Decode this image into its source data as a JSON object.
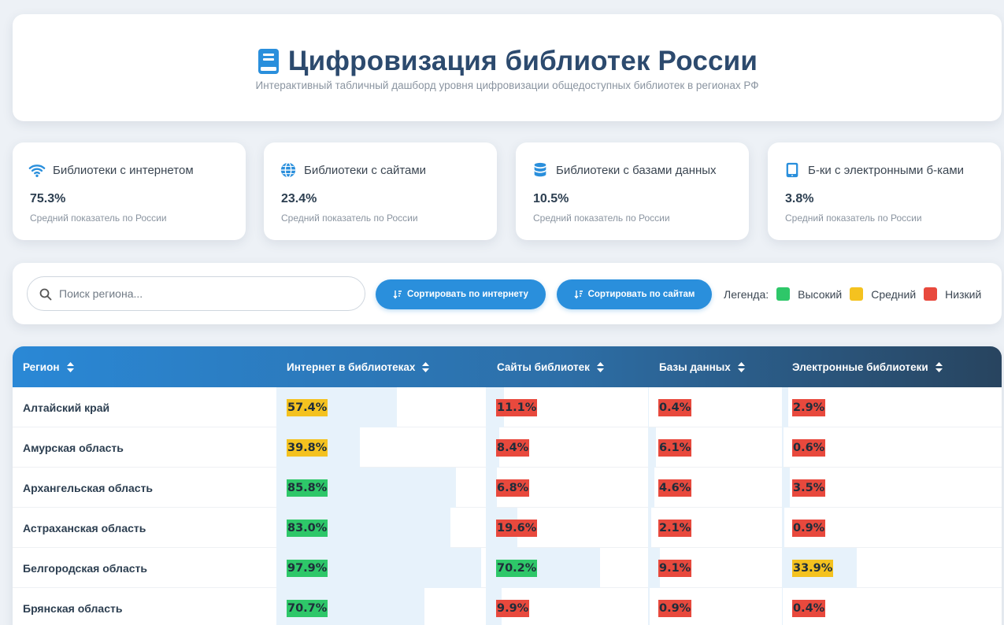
{
  "header": {
    "title": "Цифровизация библиотек России",
    "subtitle": "Интерактивный табличный дашборд уровня цифровизации общедоступных библиотек в регионах РФ"
  },
  "stats": [
    {
      "label": "Библиотеки с интернетом",
      "value": "75.3%",
      "note": "Средний показатель по России",
      "icon": "wifi-icon"
    },
    {
      "label": "Библиотеки с сайтами",
      "value": "23.4%",
      "note": "Средний показатель по России",
      "icon": "globe-icon"
    },
    {
      "label": "Библиотеки с базами данных",
      "value": "10.5%",
      "note": "Средний показатель по России",
      "icon": "database-icon"
    },
    {
      "label": "Б-ки с электронными б-ками",
      "value": "3.8%",
      "note": "Средний показатель по России",
      "icon": "tablet-icon"
    }
  ],
  "controls": {
    "search_placeholder": "Поиск региона...",
    "sort_internet": "Сортировать по интернету",
    "sort_sites": "Сортировать по сайтам",
    "legend_label": "Легенда:",
    "legend_high": "Высокий",
    "legend_mid": "Средний",
    "legend_low": "Низкий"
  },
  "colors": {
    "high": "#2ec769",
    "mid": "#f4c21f",
    "low": "#e8493d",
    "bar_bg": "#e7f2fb",
    "accent": "#2a8fdc"
  },
  "table": {
    "columns": [
      "Регион",
      "Интернет в библиотеках",
      "Сайты библиотек",
      "Базы данных",
      "Электронные библиотеки"
    ],
    "rows": [
      {
        "region": "Алтайский край",
        "values": [
          57.4,
          11.1,
          0.4,
          2.9
        ],
        "text": [
          "57.4%",
          "11.1%",
          "0.4%",
          "2.9%"
        ],
        "levels": [
          "mid",
          "low",
          "low",
          "low"
        ]
      },
      {
        "region": "Амурская область",
        "values": [
          39.8,
          8.4,
          6.1,
          0.6
        ],
        "text": [
          "39.8%",
          "8.4%",
          "6.1%",
          "0.6%"
        ],
        "levels": [
          "mid",
          "low",
          "low",
          "low"
        ]
      },
      {
        "region": "Архангельская область",
        "values": [
          85.8,
          6.8,
          4.6,
          3.5
        ],
        "text": [
          "85.8%",
          "6.8%",
          "4.6%",
          "3.5%"
        ],
        "levels": [
          "high",
          "low",
          "low",
          "low"
        ]
      },
      {
        "region": "Астраханская область",
        "values": [
          83.0,
          19.6,
          2.1,
          0.9
        ],
        "text": [
          "83.0%",
          "19.6%",
          "2.1%",
          "0.9%"
        ],
        "levels": [
          "high",
          "low",
          "low",
          "low"
        ]
      },
      {
        "region": "Белгородская область",
        "values": [
          97.9,
          70.2,
          9.1,
          33.9
        ],
        "text": [
          "97.9%",
          "70.2%",
          "9.1%",
          "33.9%"
        ],
        "levels": [
          "high",
          "high",
          "low",
          "mid"
        ]
      },
      {
        "region": "Брянская область",
        "values": [
          70.7,
          9.9,
          0.9,
          0.4
        ],
        "text": [
          "70.7%",
          "9.9%",
          "0.9%",
          "0.4%"
        ],
        "levels": [
          "high",
          "low",
          "low",
          "low"
        ]
      }
    ]
  }
}
